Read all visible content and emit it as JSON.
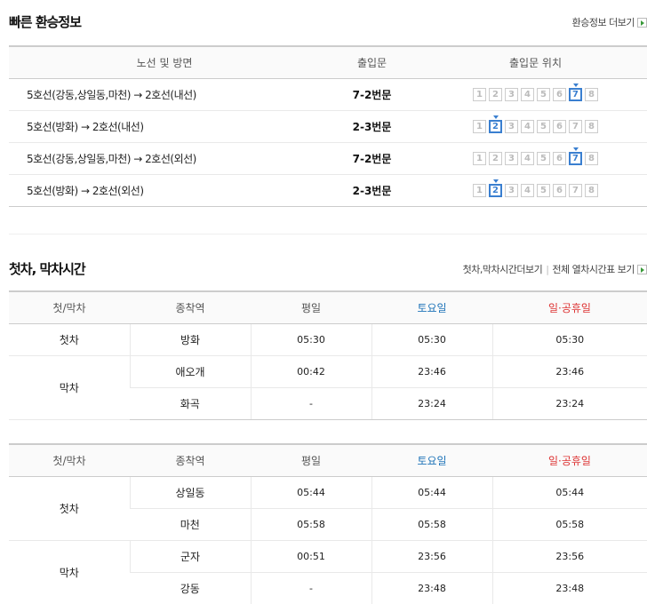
{
  "transfer": {
    "title": "빠른 환승정보",
    "more_label": "환승정보 더보기",
    "headers": [
      "노선 및 방면",
      "출입문",
      "출입문 위치"
    ],
    "car_numbers": [
      "1",
      "2",
      "3",
      "4",
      "5",
      "6",
      "7",
      "8"
    ],
    "rows": [
      {
        "route": "5호선(강동,상일동,마천) → 2호선(내선)",
        "gate": "7-2번문",
        "active_car": 7
      },
      {
        "route": "5호선(방화) → 2호선(내선)",
        "gate": "2-3번문",
        "active_car": 2
      },
      {
        "route": "5호선(강동,상일동,마천) → 2호선(외선)",
        "gate": "7-2번문",
        "active_car": 7
      },
      {
        "route": "5호선(방화) → 2호선(외선)",
        "gate": "2-3번문",
        "active_car": 2
      }
    ]
  },
  "timetable": {
    "title": "첫차, 막차시간",
    "more_label": "첫차,막차시간더보기",
    "full_label": "전체 열차시간표 보기",
    "headers": [
      "첫/막차",
      "종착역",
      "평일",
      "토요일",
      "일·공휴일"
    ],
    "colors": {
      "saturday": "#1e73b8",
      "holiday": "#d33333"
    },
    "first_label": "첫차",
    "last_label": "막차",
    "table1": {
      "first": [
        {
          "station": "방화",
          "weekday": "05:30",
          "saturday": "05:30",
          "holiday": "05:30"
        }
      ],
      "last": [
        {
          "station": "애오개",
          "weekday": "00:42",
          "saturday": "23:46",
          "holiday": "23:46"
        },
        {
          "station": "화곡",
          "weekday": "-",
          "saturday": "23:24",
          "holiday": "23:24"
        }
      ]
    },
    "table2": {
      "first": [
        {
          "station": "상일동",
          "weekday": "05:44",
          "saturday": "05:44",
          "holiday": "05:44"
        },
        {
          "station": "마천",
          "weekday": "05:58",
          "saturday": "05:58",
          "holiday": "05:58"
        }
      ],
      "last": [
        {
          "station": "군자",
          "weekday": "00:51",
          "saturday": "23:56",
          "holiday": "23:56"
        },
        {
          "station": "강동",
          "weekday": "-",
          "saturday": "23:48",
          "holiday": "23:48"
        }
      ]
    }
  }
}
